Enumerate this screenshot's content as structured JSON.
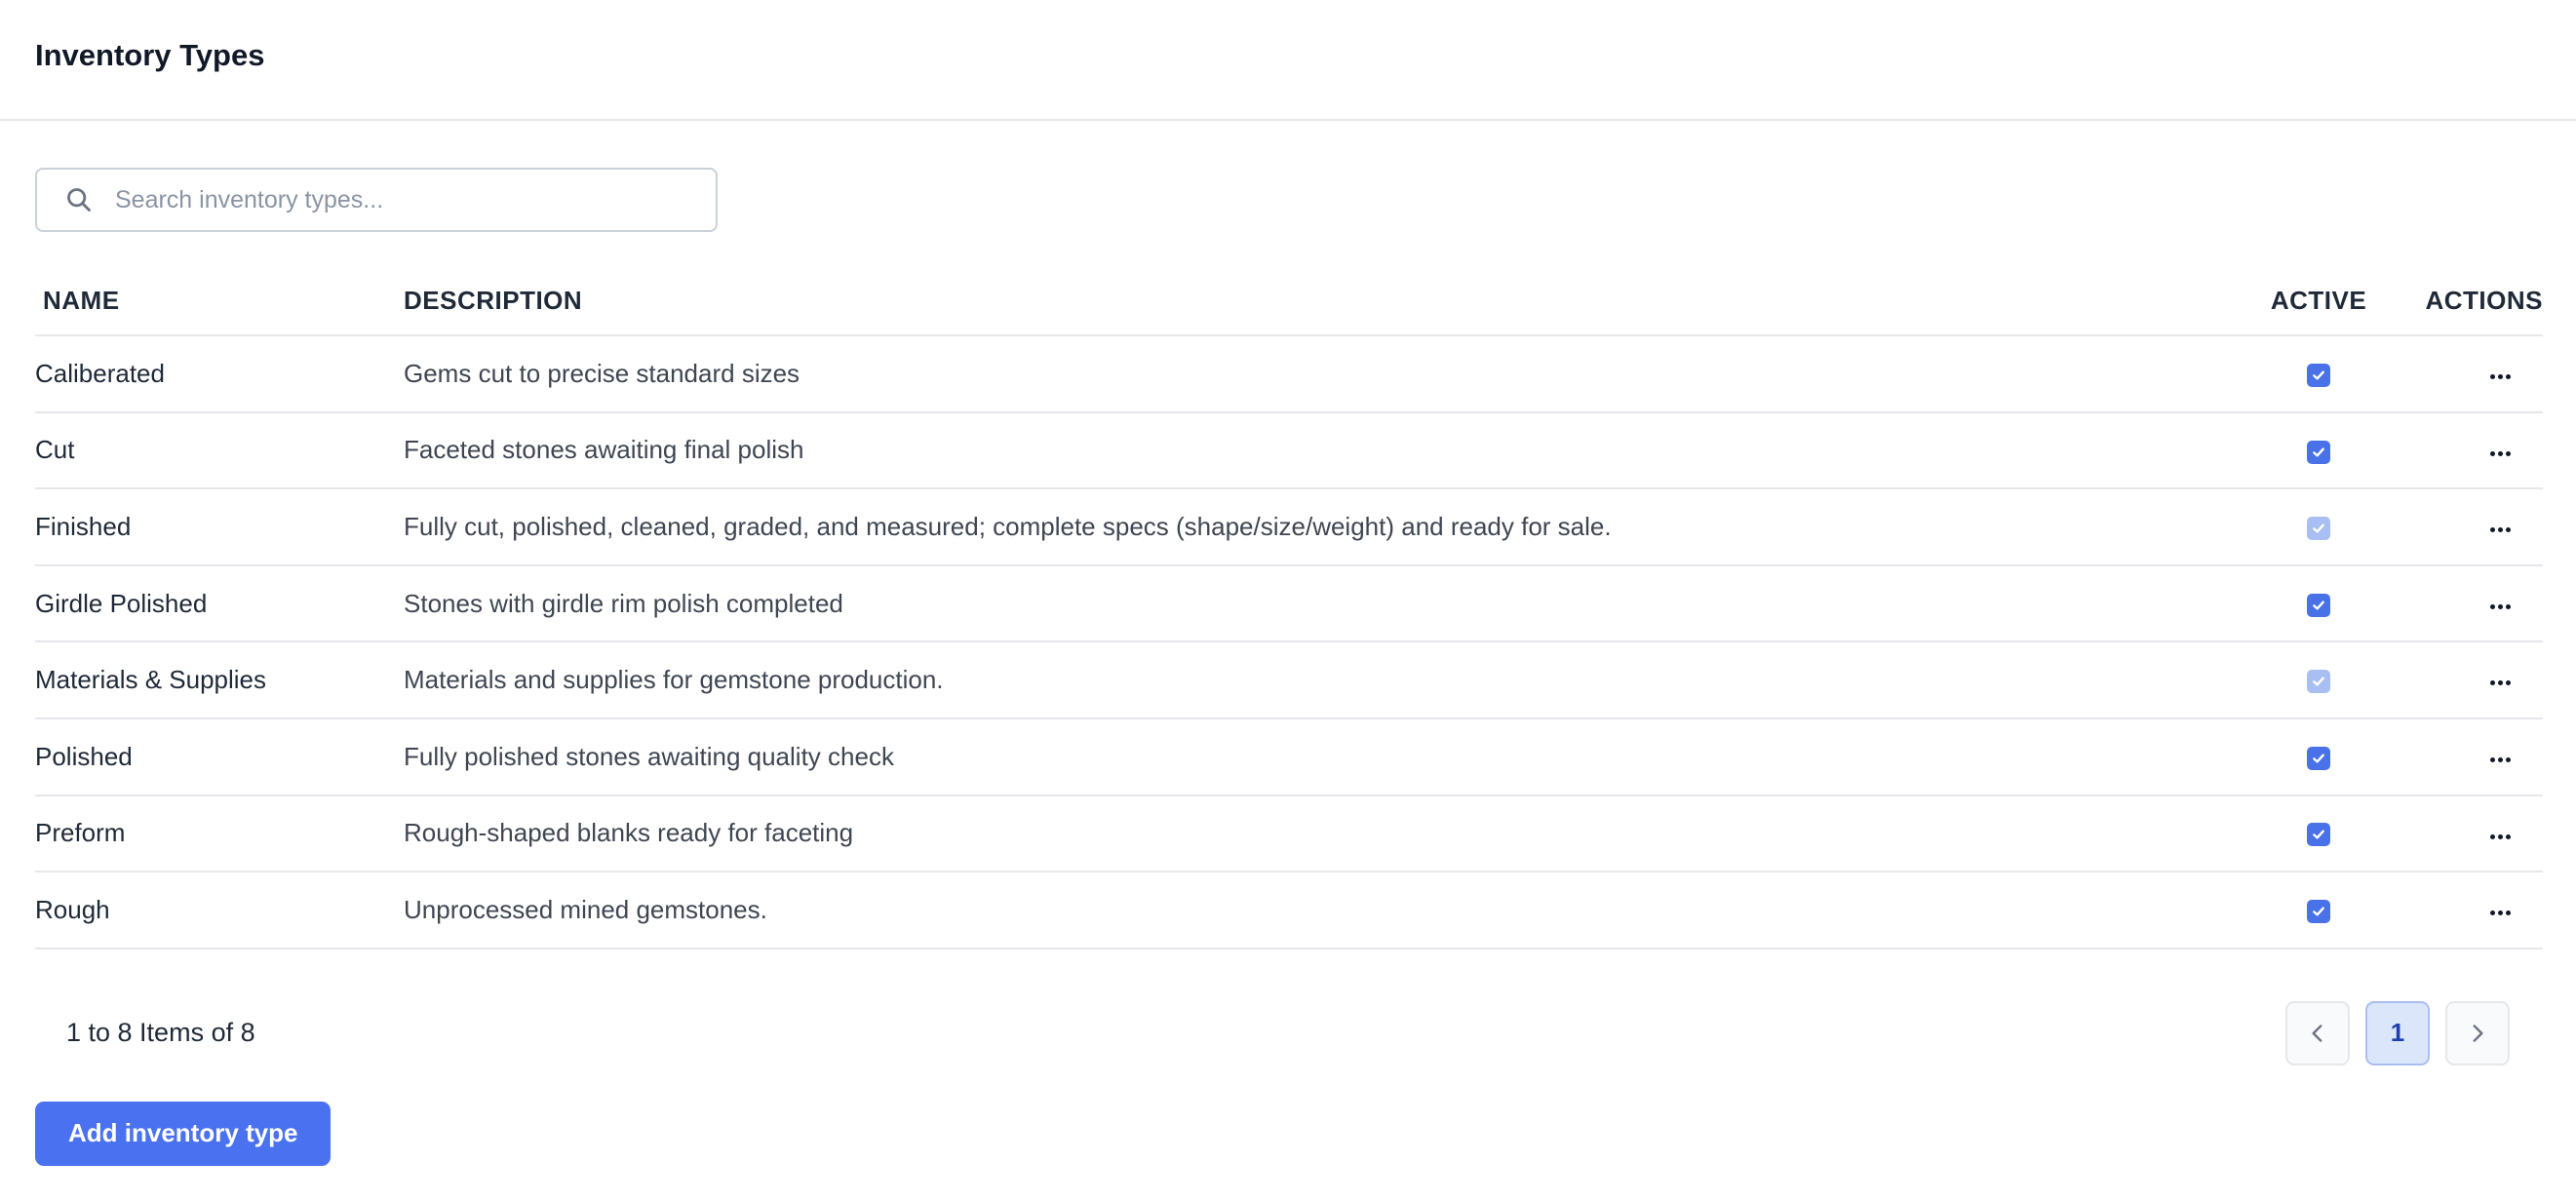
{
  "header": {
    "title": "Inventory Types"
  },
  "search": {
    "placeholder": "Search inventory types..."
  },
  "table": {
    "columns": {
      "name": "NAME",
      "description": "DESCRIPTION",
      "active": "ACTIVE",
      "actions": "ACTIONS"
    },
    "rows": [
      {
        "name": "Caliberated",
        "description": "Gems cut to precise standard sizes",
        "active": true,
        "dimmed": false
      },
      {
        "name": "Cut",
        "description": "Faceted stones awaiting final polish",
        "active": true,
        "dimmed": false
      },
      {
        "name": "Finished",
        "description": "Fully cut, polished, cleaned, graded, and measured; complete specs (shape/size/weight) and ready for sale.",
        "active": true,
        "dimmed": true
      },
      {
        "name": "Girdle Polished",
        "description": "Stones with girdle rim polish completed",
        "active": true,
        "dimmed": false
      },
      {
        "name": "Materials & Supplies",
        "description": "Materials and supplies for gemstone production.",
        "active": true,
        "dimmed": true
      },
      {
        "name": "Polished",
        "description": "Fully polished stones awaiting quality check",
        "active": true,
        "dimmed": false
      },
      {
        "name": "Preform",
        "description": "Rough-shaped blanks ready for faceting",
        "active": true,
        "dimmed": false
      },
      {
        "name": "Rough",
        "description": "Unprocessed mined gemstones.",
        "active": true,
        "dimmed": false
      }
    ]
  },
  "pagination": {
    "summary": "1 to 8 Items of 8",
    "current_page": "1"
  },
  "actions": {
    "add_label": "Add inventory type"
  },
  "colors": {
    "accent": "#4a72f0",
    "checkbox": "#4a72e8",
    "checkbox_dimmed": "#a9bff3",
    "border": "#e5e7eb"
  },
  "icons": {
    "search": "search-icon",
    "row_menu": "more-horizontal-icon",
    "check": "check-icon",
    "prev": "chevron-left-icon",
    "next": "chevron-right-icon"
  }
}
